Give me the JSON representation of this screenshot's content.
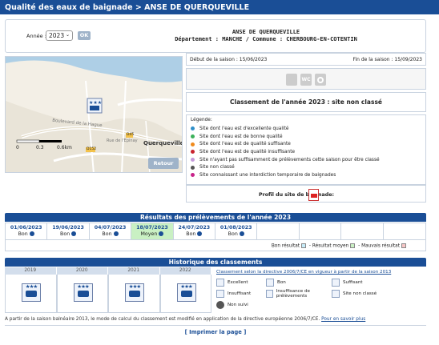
{
  "topbar": {
    "title": "Qualité des eaux de baignade > ANSE DE QUERQUEVILLE"
  },
  "year_filter": {
    "label": "Année :",
    "selected": "2023",
    "ok_label": "OK"
  },
  "site": {
    "name": "ANSE DE QUERQUEVILLE",
    "location": "Département : MANCHE   /   Commune : CHERBOURG-EN-COTENTIN"
  },
  "map": {
    "street_label": "Boulevard de la Hague",
    "street_label2": "Rue de l'Epinay",
    "town_label": "Querqueville",
    "road_d45": "D45",
    "road_d152": "D152",
    "scale_0": "0",
    "scale_1": "0.3",
    "scale_2": "0.6km",
    "retour_label": "Retour"
  },
  "season": {
    "debut": "Début de la saison :  15/06/2023",
    "fin": "Fin de la saison :  15/09/2023"
  },
  "icons": {
    "wc": "WC"
  },
  "classement": "Classement de l'année 2023 : site non classé",
  "legend": {
    "title": "Légende:",
    "items": [
      {
        "label": "Site dont l'eau est d'excellente qualité",
        "color": "#2f8fc9"
      },
      {
        "label": "Site dont l'eau est de bonne qualité",
        "color": "#3cb15a"
      },
      {
        "label": "Site dont l'eau est de qualité suffisante",
        "color": "#f08a1c"
      },
      {
        "label": "Site dont l'eau est de qualité insuffisante",
        "color": "#c9232f"
      },
      {
        "label": "Site n'ayant pas suffisamment de prélèvements cette saison pour être classé",
        "color": "#c59adb"
      },
      {
        "label": "Site non classé",
        "color": "#555555"
      },
      {
        "label": "Site connaissant une interdiction temporaire de baignades",
        "color": "#c8248a"
      }
    ]
  },
  "profil": {
    "label": "Profil du site de baignade:"
  },
  "results": {
    "title": "Résultats des prélèvements de l'année 2023",
    "cells": [
      {
        "date": "01/06/2023",
        "result": "Bon",
        "moyen": false
      },
      {
        "date": "19/06/2023",
        "result": "Bon",
        "moyen": false
      },
      {
        "date": "04/07/2023",
        "result": "Bon",
        "moyen": false
      },
      {
        "date": "18/07/2023",
        "result": "Moyen",
        "moyen": true
      },
      {
        "date": "24/07/2023",
        "result": "Bon",
        "moyen": false
      },
      {
        "date": "01/08/2023",
        "result": "Bon",
        "moyen": false
      },
      {
        "date": "",
        "result": "",
        "moyen": false
      },
      {
        "date": "",
        "result": "",
        "moyen": false
      },
      {
        "date": "",
        "result": "",
        "moyen": false
      },
      {
        "date": "",
        "result": "",
        "moyen": false
      }
    ],
    "legend_bon": "Bon résultat",
    "legend_moyen": "- Résultat moyen",
    "legend_mauvais": "- Mauvais résultat",
    "colors": {
      "bon": "#c7ecf9",
      "moyen": "#c9f0c3",
      "mauvais": "#f6c6c6"
    }
  },
  "history": {
    "title": "Historique des classements",
    "years": [
      "2019",
      "2020",
      "2021",
      "2022"
    ],
    "legend_title": "Classement selon la directive 2006/7/CE en vigueur à partir de la saison 2013",
    "legend_items": [
      "Excellent",
      "Bon",
      "Suffisant",
      "Insuffisant",
      "Insuffisance de prélèvements",
      "Site non classé",
      "Non suivi"
    ]
  },
  "footnote": {
    "text": "A partir de la saison balnéaire 2013, le mode de calcul du classement est modifié en application de la directive européenne 2006/7/CE.",
    "link": "Pour en savoir plus"
  },
  "print_label": "[ Imprimer la page ]"
}
